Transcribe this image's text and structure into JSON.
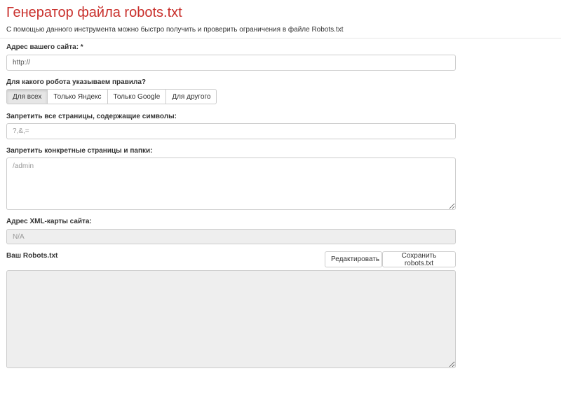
{
  "header": {
    "title": "Генератор файла robots.txt",
    "subtitle": "С помощью данного инструмента можно быстро получить и проверить ограничения в файле Robots.txt"
  },
  "site_url": {
    "label": "Адрес вашего сайта: *",
    "value": "http://"
  },
  "robot": {
    "label": "Для какого робота указываем правила?",
    "options": [
      "Для всех",
      "Только Яндекс",
      "Только Google",
      "Для другого"
    ],
    "selected": "Для всех"
  },
  "forbid_symbols": {
    "label": "Запретить все страницы, содержащие символы:",
    "placeholder": "?,&,="
  },
  "forbid_pages": {
    "label": "Запретить конкретные страницы и папки:",
    "placeholder": "/admin"
  },
  "sitemap": {
    "label": "Адрес XML-карты сайта:",
    "value": "N/A"
  },
  "result": {
    "label": "Ваш Robots.txt",
    "edit_label": "Редактировать",
    "save_label": "Сохранить robots.txt",
    "value": ""
  },
  "colors": {
    "title": "#c9302c",
    "border": "#cccccc",
    "readonly_bg": "#eeeeee"
  }
}
